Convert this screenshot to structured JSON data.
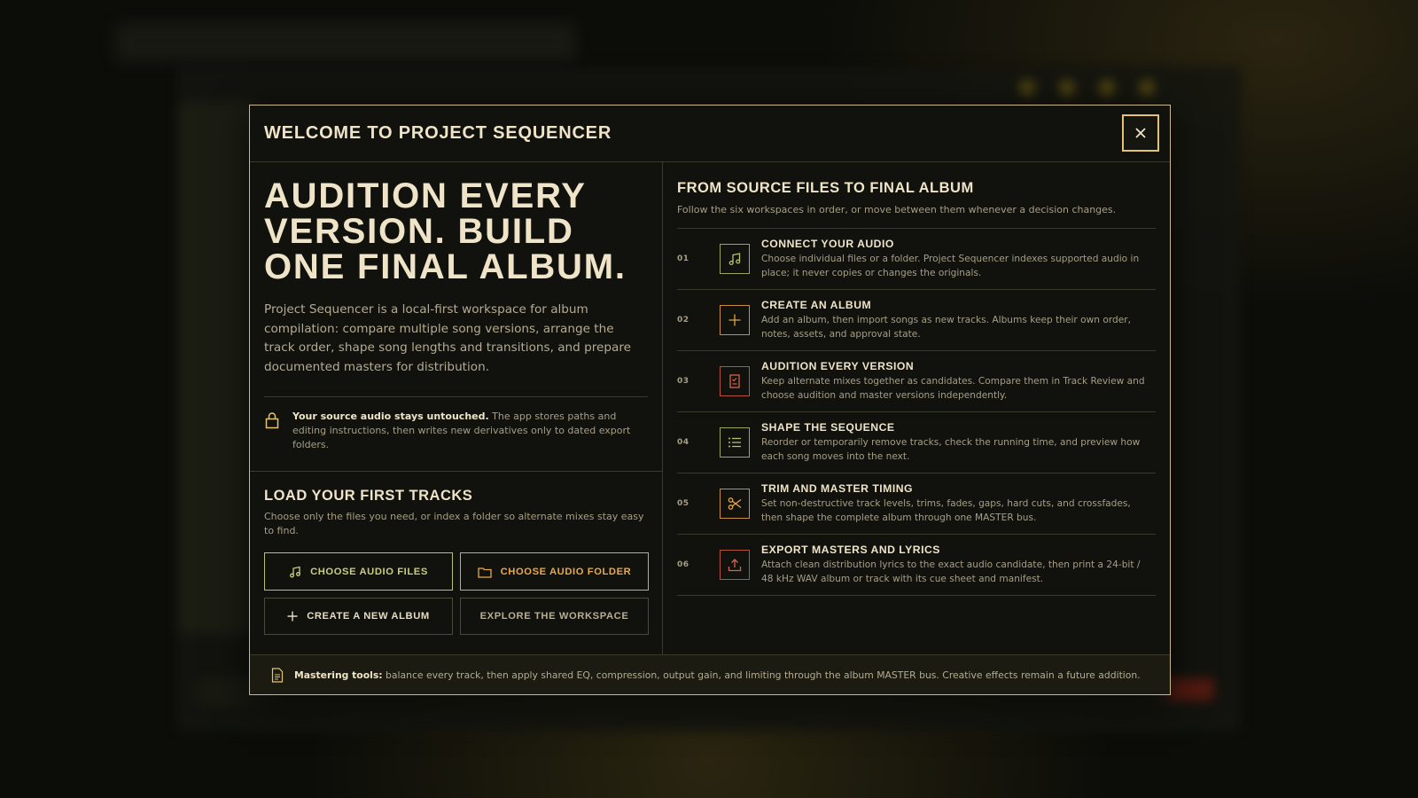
{
  "colors": {
    "accent_gold": "#e2c473",
    "green": "#b9c26f",
    "orange": "#e0a44c",
    "red": "#d7634a",
    "modal_bg": "#11120d"
  },
  "modal": {
    "title": "WELCOME TO PROJECT SEQUENCER",
    "close_icon": "close-icon"
  },
  "intro": {
    "headline": "AUDITION EVERY VERSION. BUILD ONE FINAL ALBUM.",
    "lead": "Project Sequencer is a local-first workspace for album compilation: compare multiple song versions, arrange the track order, shape song lengths and transitions, and prepare documented masters for distribution.",
    "note_bold": "Your source audio stays untouched.",
    "note_rest": " The app stores paths and editing instructions, then writes new derivatives only to dated export folders.",
    "note_icon": "lock-icon"
  },
  "load": {
    "title": "LOAD YOUR FIRST TRACKS",
    "subtitle": "Choose only the files you need, or index a folder so alternate mixes stay easy to find.",
    "buttons": {
      "choose_files": "CHOOSE AUDIO FILES",
      "choose_folder": "CHOOSE AUDIO FOLDER",
      "create_album": "CREATE A NEW ALBUM",
      "explore": "EXPLORE THE WORKSPACE"
    }
  },
  "workflow": {
    "title": "FROM SOURCE FILES TO FINAL ALBUM",
    "subtitle": "Follow the six workspaces in order, or move between them whenever a decision changes.",
    "steps": [
      {
        "num": "01",
        "title": "CONNECT YOUR AUDIO",
        "desc": "Choose individual files or a folder. Project Sequencer indexes supported audio in place; it never copies or changes the originals.",
        "icon": "music-note-icon",
        "color": "green"
      },
      {
        "num": "02",
        "title": "CREATE AN ALBUM",
        "desc": "Add an album, then import songs as new tracks. Albums keep their own order, notes, assets, and approval state.",
        "icon": "plus-icon",
        "color": "orange"
      },
      {
        "num": "03",
        "title": "AUDITION EVERY VERSION",
        "desc": "Keep alternate mixes together as candidates. Compare them in Track Review and choose audition and master versions independently.",
        "icon": "checklist-document-icon",
        "color": "red"
      },
      {
        "num": "04",
        "title": "SHAPE THE SEQUENCE",
        "desc": "Reorder or temporarily remove tracks, check the running time, and preview how each song moves into the next.",
        "icon": "list-icon",
        "color": "green"
      },
      {
        "num": "05",
        "title": "TRIM AND MASTER TIMING",
        "desc": "Set non-destructive track levels, trims, fades, gaps, hard cuts, and crossfades, then shape the complete album through one MASTER bus.",
        "icon": "scissors-icon",
        "color": "orange"
      },
      {
        "num": "06",
        "title": "EXPORT MASTERS AND LYRICS",
        "desc": "Attach clean distribution lyrics to the exact audio candidate, then print a 24-bit / 48 kHz WAV album or track with its cue sheet and manifest.",
        "icon": "upload-icon",
        "color": "red"
      }
    ]
  },
  "footer": {
    "label": "Mastering tools:",
    "text": " balance every track, then apply shared EQ, compression, output gain, and limiting through the album MASTER bus. Creative effects remain a future addition.",
    "icon": "document-icon"
  }
}
